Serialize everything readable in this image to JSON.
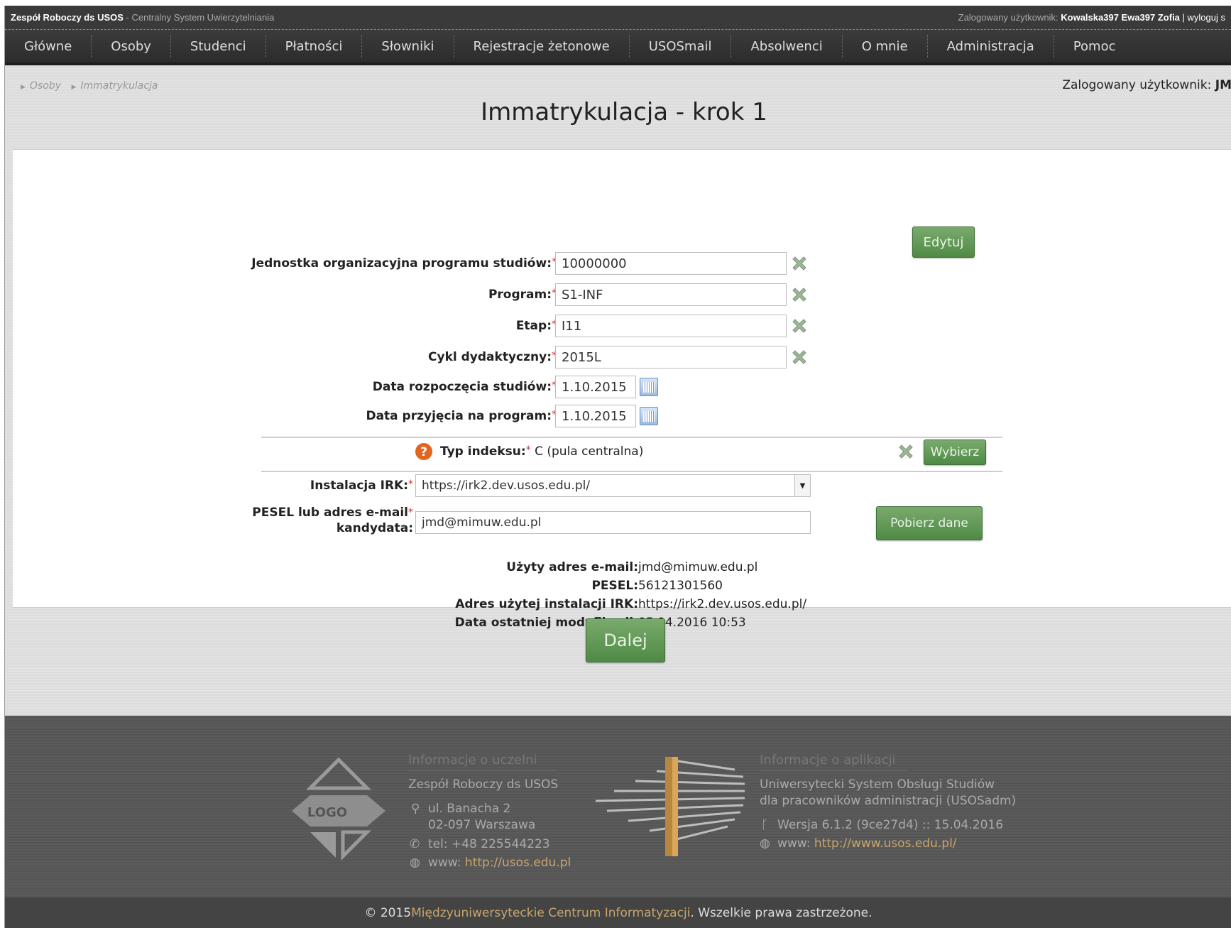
{
  "topbar": {
    "brand": "Zespół Roboczy ds USOS",
    "subtitle": " - Centralny System Uwierzytelniania",
    "logged_prefix": "Zalogowany użytkownik: ",
    "logged_user": "Kowalska397 Ewa397 Zofia",
    "logout": " | wyloguj s"
  },
  "nav": {
    "items": [
      "Główne",
      "Osoby",
      "Studenci",
      "Płatności",
      "Słowniki",
      "Rejestracje żetonowe",
      "USOSmail",
      "Absolwenci",
      "O mnie",
      "Administracja",
      "Pomoc"
    ]
  },
  "breadcrumb": {
    "items": [
      "Osoby",
      "Immatrykulacja"
    ]
  },
  "logged": {
    "prefix": "Zalogowany użytkownik: ",
    "user": "JM"
  },
  "page": {
    "title": "Immatrykulacja - krok 1"
  },
  "form": {
    "edit_label": "Edytuj",
    "unit_label": "Jednostka organizacyjna programu studiów:",
    "unit_value": "10000000",
    "program_label": "Program:",
    "program_value": "S1-INF",
    "stage_label": "Etap:",
    "stage_value": "I11",
    "cycle_label": "Cykl dydaktyczny:",
    "cycle_value": "2015L",
    "start_label": "Data rozpoczęcia studiów:",
    "start_value": "1.10.2015",
    "admission_label": "Data przyjęcia na program:",
    "admission_value": "1.10.2015",
    "index_type_label": "Typ indeksu:",
    "index_type_value": "C (pula centralna)",
    "choose_label": "Wybierz",
    "irk_label": "Instalacja IRK:",
    "irk_value": "https://irk2.dev.usos.edu.pl/",
    "pesel_label_1": "PESEL lub adres e-mail",
    "pesel_label_2": "kandydata:",
    "pesel_value": "jmd@mimuw.edu.pl",
    "fetch_label": "Pobierz dane",
    "required_mark": "*"
  },
  "info": {
    "email_label": "Użyty adres e-mail:",
    "email_value": "jmd@mimuw.edu.pl",
    "pesel_label": "PESEL:",
    "pesel_value": "56121301560",
    "irk_label": "Adres użytej instalacji IRK:",
    "irk_value": "https://irk2.dev.usos.edu.pl/",
    "modified_label": "Data ostatniej modyfikacji:",
    "modified_value": "05.04.2016 10:53"
  },
  "next_label": "Dalej",
  "footer": {
    "uni_title": "Informacje o uczelni",
    "uni_name": "Zespół Roboczy ds USOS",
    "uni_address1": "ul. Banacha 2",
    "uni_address2": "02-097 Warszawa",
    "uni_tel": "tel: +48 225544223",
    "uni_www_label": "www: ",
    "uni_www_link": "http://usos.edu.pl",
    "logo_text": "LOGO",
    "app_title": "Informacje o aplikacji",
    "app_name1": "Uniwersytecki System Obsługi Studiów",
    "app_name2": "dla pracowników administracji (USOSadm)",
    "app_version": "Wersja 6.1.2 (9ce27d4) :: 15.04.2016",
    "app_www_label": "www: ",
    "app_www_link": "http://www.usos.edu.pl/"
  },
  "copyright": {
    "prefix": "© 2015 ",
    "org": "Międzyuniwersyteckie Centrum Informatyzacji",
    "suffix": ". Wszelkie prawa zastrzeżone."
  },
  "colors": {
    "accent_green": "#5b9550",
    "link_gold": "#c9a66b",
    "required_red": "#cc3333"
  }
}
